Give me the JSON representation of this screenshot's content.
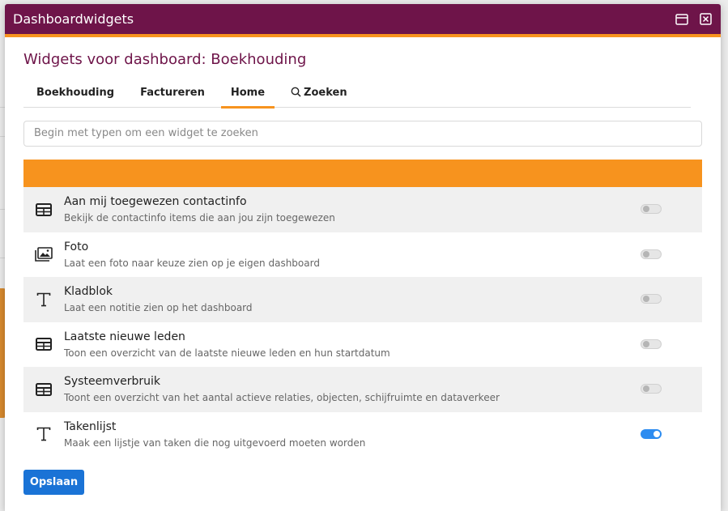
{
  "window": {
    "title": "Dashboardwidgets"
  },
  "heading": "Widgets voor dashboard: Boekhouding",
  "tabs": [
    {
      "label": "Boekhouding"
    },
    {
      "label": "Factureren"
    },
    {
      "label": "Home"
    },
    {
      "label": "Zoeken"
    }
  ],
  "search": {
    "placeholder": "Begin met typen om een widget te zoeken"
  },
  "widgets": [
    {
      "name": "Aan mij toegewezen contactinfo",
      "description": "Bekijk de contactinfo items die aan jou zijn toegewezen",
      "icon": "table-icon",
      "enabled": false
    },
    {
      "name": "Foto",
      "description": "Laat een foto naar keuze zien op je eigen dashboard",
      "icon": "image-icon",
      "enabled": false
    },
    {
      "name": "Kladblok",
      "description": "Laat een notitie zien op het dashboard",
      "icon": "text-icon",
      "enabled": false
    },
    {
      "name": "Laatste nieuwe leden",
      "description": "Toon een overzicht van de laatste nieuwe leden en hun startdatum",
      "icon": "table-icon",
      "enabled": false
    },
    {
      "name": "Systeemverbruik",
      "description": "Toont een overzicht van het aantal actieve relaties, objecten, schijfruimte en dataverkeer",
      "icon": "table-icon",
      "enabled": false
    },
    {
      "name": "Takenlijst",
      "description": "Maak een lijstje van taken die nog uitgevoerd moeten worden",
      "icon": "text-icon",
      "enabled": true
    }
  ],
  "save_label": "Opslaan",
  "colors": {
    "brand": "#6e1449",
    "accent": "#f7931e",
    "primary": "#1a73d6"
  }
}
